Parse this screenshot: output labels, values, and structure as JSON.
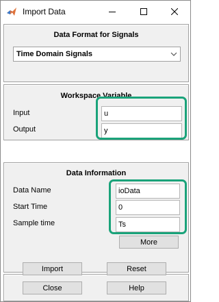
{
  "window": {
    "title": "Import Data",
    "accent_color": "#1aa37a"
  },
  "format_panel": {
    "title": "Data Format for Signals",
    "selected": "Time Domain Signals"
  },
  "workspace_panel": {
    "title": "Workspace Variable",
    "input_label": "Input",
    "input_value": "u",
    "output_label": "Output",
    "output_value": "y"
  },
  "info_panel": {
    "title": "Data Information",
    "name_label": "Data Name",
    "name_value": "ioData",
    "start_label": "Start Time",
    "start_value": "0",
    "sample_label": "Sample time",
    "sample_value": "Ts",
    "more_label": "More"
  },
  "actions": {
    "import_label": "Import",
    "reset_label": "Reset",
    "close_label": "Close",
    "help_label": "Help"
  }
}
